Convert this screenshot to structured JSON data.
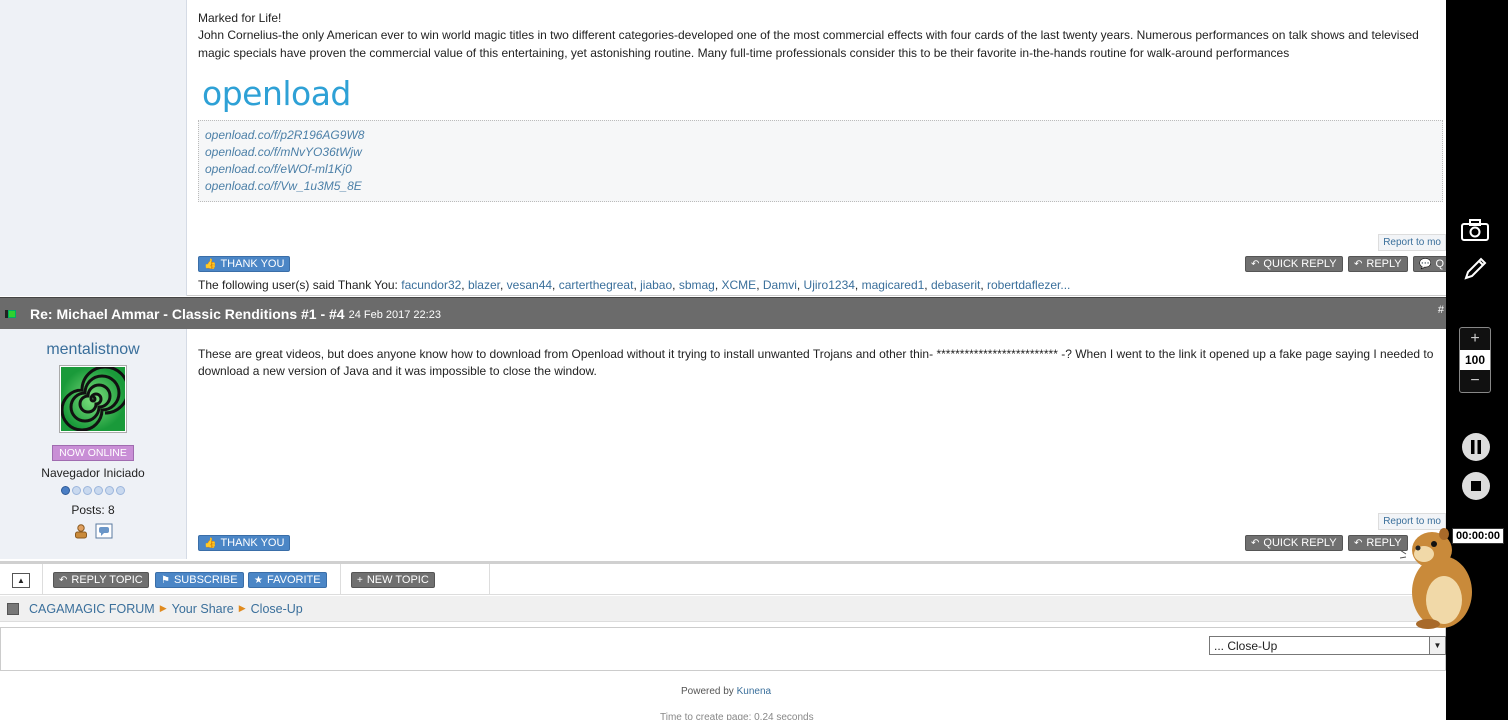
{
  "post1": {
    "title_line": "Marked for Life!",
    "text": "John Cornelius-the only American ever to win world magic titles in two different categories-developed one of the most commercial effects with four cards of the last twenty years. Numerous performances on talk shows and televised magic specials have proven the commercial value of this entertaining, yet astonishing routine. Many full-time professionals consider this to be their favorite in-the-hands routine for walk-around performances",
    "logo_text": "openload",
    "links": [
      "openload.co/f/p2R196AG9W8",
      "openload.co/f/mNvYO36tWjw",
      "openload.co/f/eWOf-ml1Kj0",
      "openload.co/f/Vw_1u3M5_8E"
    ],
    "report_label": "Report to mo",
    "thank_you_label": "THANK YOU",
    "quick_reply_label": "QUICK REPLY",
    "reply_label": "REPLY",
    "quote_label": "Q",
    "thanks_prefix": "The following user(s) said Thank You:",
    "thanked_users": [
      "facundor32",
      "blazer",
      "vesan44",
      "carterthegreat",
      "jiabao",
      "sbmag",
      "XCME",
      "Damvi",
      "Ujiro1234",
      "magicared1",
      "debaserit",
      "robertdaflezer..."
    ]
  },
  "post2_header": {
    "title": "Re: Michael Ammar - Classic Renditions #1 - #4",
    "date": "24 Feb 2017 22:23",
    "hash": "#"
  },
  "post2": {
    "username": "mentalistnow",
    "status": "NOW ONLINE",
    "rank": "Navegador Iniciado",
    "posts": "Posts: 8",
    "text": "These are great videos, but does anyone know how to download from Openload without it trying to install unwanted Trojans and other thin- ************************** -? When I went to the link it opened up a fake page saying I needed to download a new version of Java and it was impossible to close the window.",
    "report_label": "Report to mo",
    "thank_you_label": "THANK YOU",
    "quick_reply_label": "QUICK REPLY",
    "reply_label": "REPLY"
  },
  "toolbar": {
    "reply_topic": "REPLY TOPIC",
    "subscribe": "SUBSCRIBE",
    "favorite": "FAVORITE",
    "new_topic": "NEW TOPIC"
  },
  "breadcrumb": [
    "CAGAMAGIC FORUM",
    "Your Share",
    "Close-Up"
  ],
  "jump_select": "... Close-Up",
  "footer": {
    "powered_prefix": "Powered by",
    "powered_link": "Kunena",
    "time_text": "Time to create page: 0.24 seconds"
  },
  "recorder": {
    "zoom_value": "100",
    "zoom_plus": "+",
    "zoom_minus": "−",
    "timer": "00:00:00"
  },
  "colors": {
    "header_bar": "#6b6b6b",
    "link": "#3a6f9b",
    "thank_button": "#4b86c6",
    "online_badge": "#c98fd6",
    "openload_blue": "#2ea1d6"
  }
}
